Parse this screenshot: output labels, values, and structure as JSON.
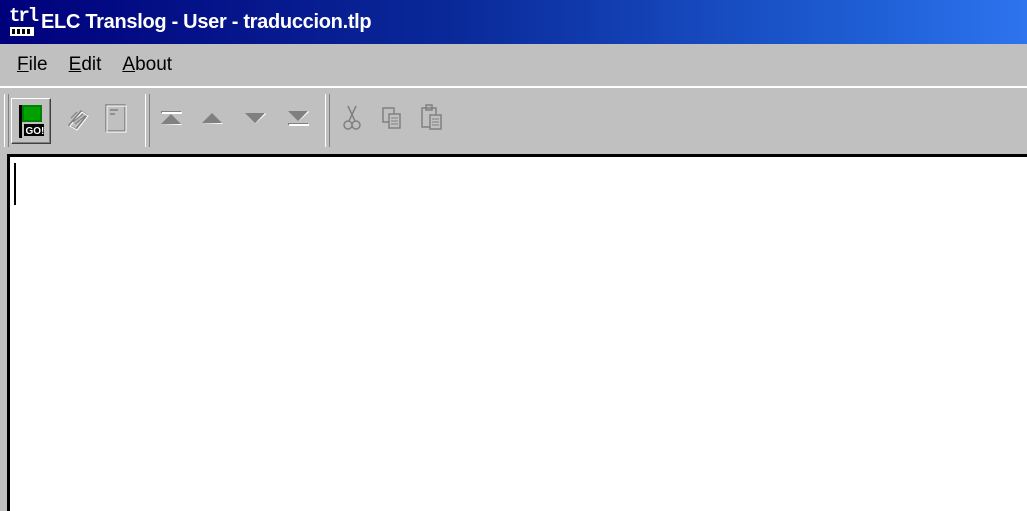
{
  "window": {
    "title": "ELC Translog - User - traduccion.tlp",
    "icon": "translog-app-icon",
    "icon_text": "trl"
  },
  "menu": {
    "items": [
      {
        "label_accel": "F",
        "label_rest": "ile"
      },
      {
        "label_accel": "E",
        "label_rest": "dit"
      },
      {
        "label_accel": "A",
        "label_rest": "bout"
      }
    ]
  },
  "toolbar": {
    "buttons": [
      {
        "icon": "go-flag-icon",
        "text": "GO!",
        "enabled": true
      },
      {
        "icon": "keyboard-hand-icon",
        "enabled": false
      },
      {
        "icon": "document-icon",
        "enabled": false
      },
      {
        "icon": "move-first-icon",
        "enabled": false
      },
      {
        "icon": "move-up-icon",
        "enabled": false
      },
      {
        "icon": "move-down-icon",
        "enabled": false
      },
      {
        "icon": "move-last-icon",
        "enabled": false
      },
      {
        "icon": "cut-icon",
        "enabled": false
      },
      {
        "icon": "copy-icon",
        "enabled": false
      },
      {
        "icon": "paste-icon",
        "enabled": false
      }
    ]
  },
  "editor": {
    "content": ""
  },
  "colors": {
    "title_start": "#00007b",
    "title_end": "#2e74ee",
    "face": "#c0c0c0",
    "go_green": "#008000"
  }
}
